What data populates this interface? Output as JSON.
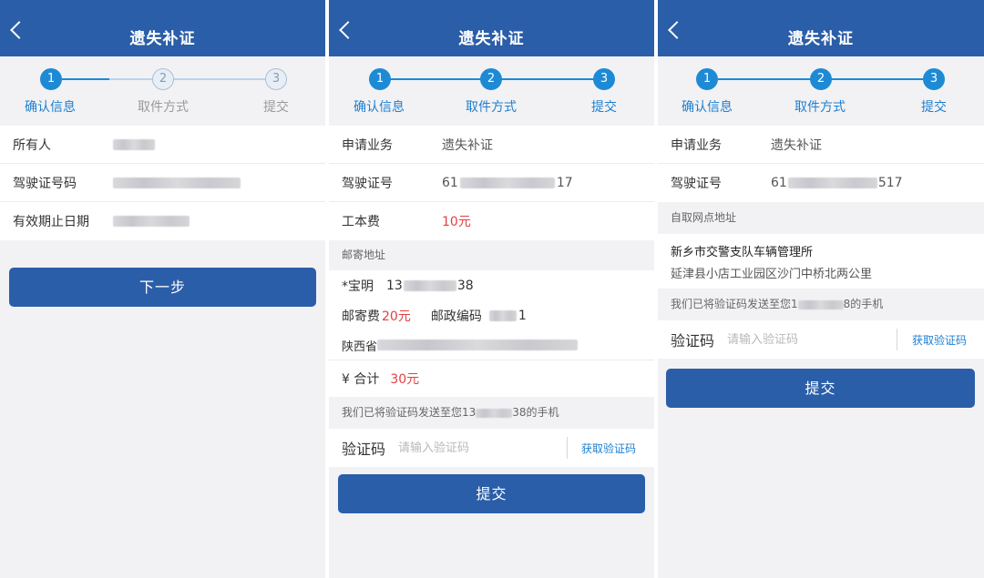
{
  "header": {
    "title": "遗失补证"
  },
  "steps": [
    "确认信息",
    "取件方式",
    "提交"
  ],
  "step_numbers": [
    "1",
    "2",
    "3"
  ],
  "panel1": {
    "rows": [
      {
        "label": "所有人"
      },
      {
        "label": "驾驶证号码"
      },
      {
        "label": "有效期止日期"
      }
    ],
    "next_button": "下一步"
  },
  "panel2": {
    "rows": [
      {
        "label": "申请业务",
        "value": "遗失补证"
      },
      {
        "label": "驾驶证号",
        "value_prefix": "61",
        "value_suffix": "17"
      },
      {
        "label": "工本费",
        "value": "10元"
      }
    ],
    "mail_section": "邮寄地址",
    "recipient_name": "*宝明",
    "recipient_phone_prefix": "13",
    "recipient_phone_suffix": "38",
    "postage_label": "邮寄费",
    "postage_value": "20元",
    "postcode_label": "邮政编码",
    "postcode_suffix": "1",
    "address_prefix": "陕西省",
    "total_label": "¥ 合计",
    "total_value": "30元",
    "sms_prefix": "我们已将验证码发送至您13",
    "sms_suffix": "38的手机",
    "code_label": "验证码",
    "code_placeholder": "请输入验证码",
    "get_code": "获取验证码",
    "submit": "提交"
  },
  "panel3": {
    "rows": [
      {
        "label": "申请业务",
        "value": "遗失补证"
      },
      {
        "label": "驾驶证号",
        "value_prefix": "61",
        "value_suffix": "517"
      }
    ],
    "pickup_section": "自取网点地址",
    "pickup_name": "新乡市交警支队车辆管理所",
    "pickup_address": "延津县小店工业园区沙门中桥北两公里",
    "sms_prefix": "我们已将验证码发送至您1",
    "sms_suffix": "8的手机",
    "code_label": "验证码",
    "code_placeholder": "请输入验证码",
    "get_code": "获取验证码",
    "submit": "提交"
  },
  "colors": {
    "header": "#2b5ea8",
    "step_active": "#1e8ad6",
    "price": "#e34040",
    "link": "#1e7fd0"
  }
}
